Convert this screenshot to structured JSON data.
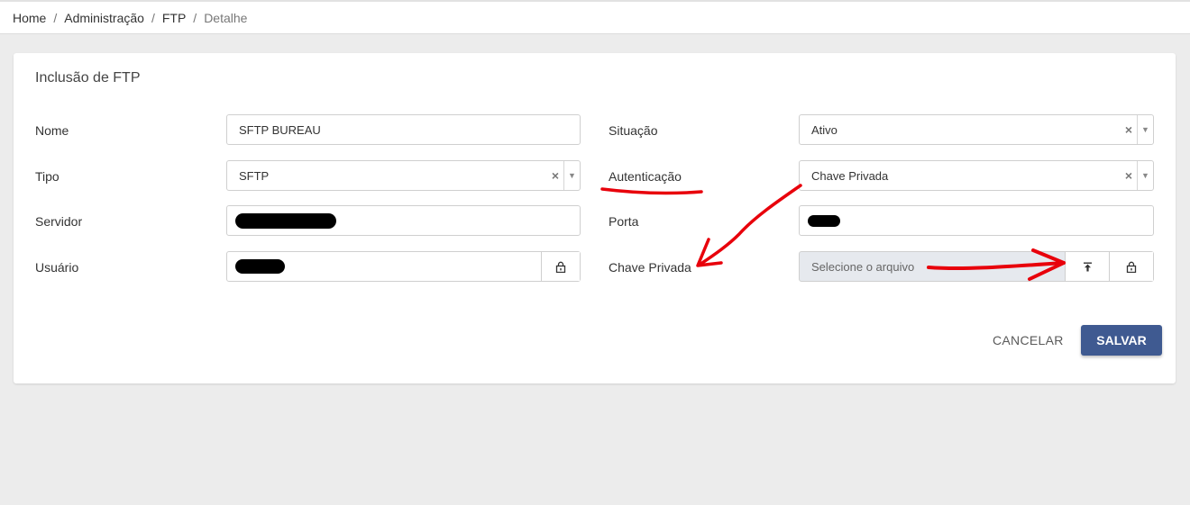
{
  "breadcrumb": {
    "items": [
      "Home",
      "Administração",
      "FTP"
    ],
    "current": "Detalhe"
  },
  "form": {
    "title": "Inclusão de FTP",
    "nome": {
      "label": "Nome",
      "value": "SFTP BUREAU"
    },
    "tipo": {
      "label": "Tipo",
      "value": "SFTP"
    },
    "servidor": {
      "label": "Servidor"
    },
    "usuario": {
      "label": "Usuário"
    },
    "situacao": {
      "label": "Situação",
      "value": "Ativo"
    },
    "autenticacao": {
      "label": "Autenticação",
      "value": "Chave Privada"
    },
    "porta": {
      "label": "Porta"
    },
    "chave_privada": {
      "label": "Chave Privada",
      "placeholder": "Selecione o arquivo"
    }
  },
  "actions": {
    "cancel_label": "CANCELAR",
    "save_label": "SALVAR"
  },
  "colors": {
    "primary": "#3f5a91",
    "annotation": "#e8000b",
    "redaction": "#000000"
  }
}
